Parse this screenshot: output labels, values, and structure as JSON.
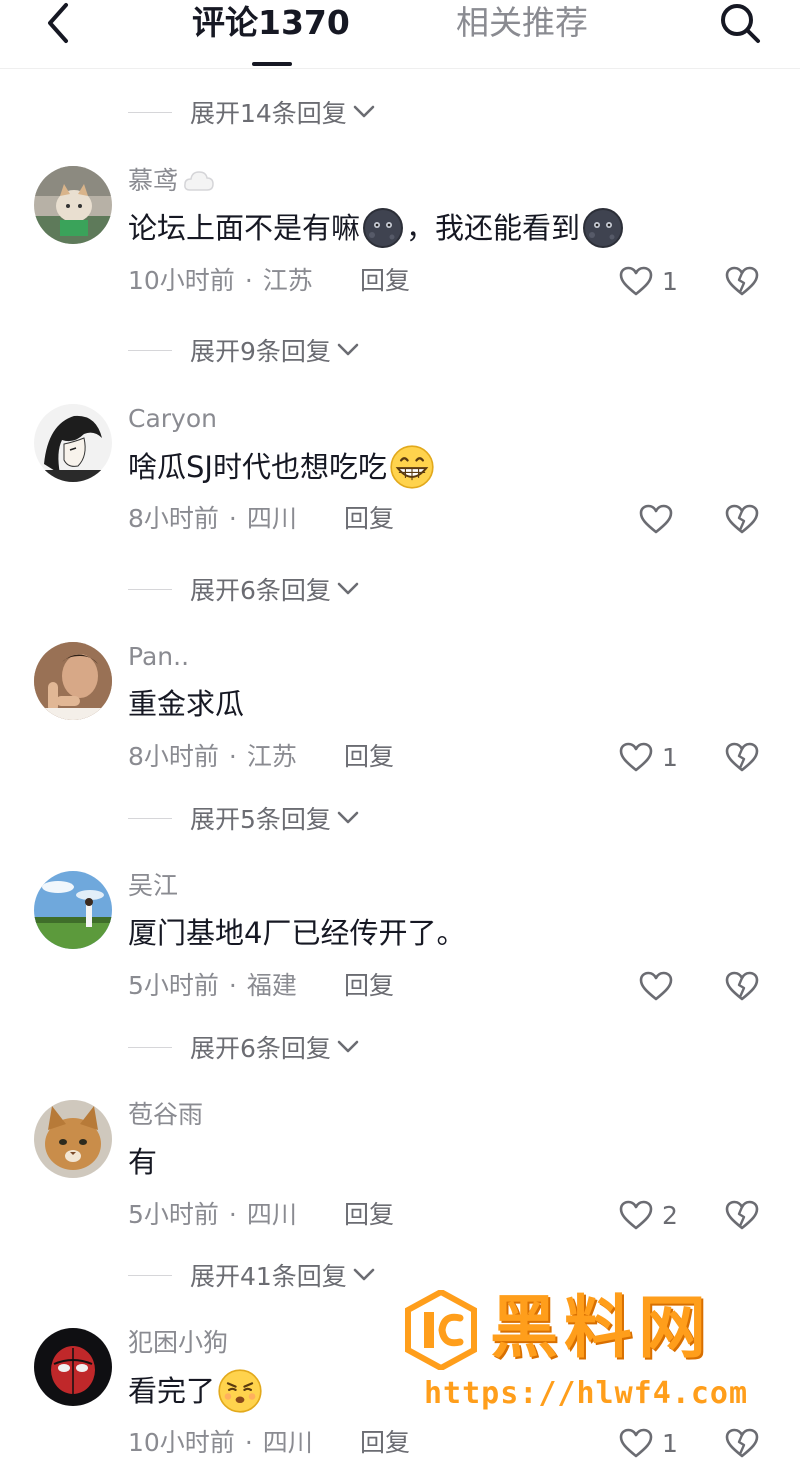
{
  "header": {
    "tab_comments": "评论1370",
    "tab_related": "相关推荐"
  },
  "expand_labels": [
    "展开14条回复",
    "展开9条回复",
    "展开6条回复",
    "展开5条回复",
    "展开6条回复",
    "展开41条回复"
  ],
  "comments": [
    {
      "user": "慕鸢",
      "text_a": "论坛上面不是有嘛",
      "text_b": "，我还能看到",
      "time": "10小时前",
      "location": "江苏",
      "reply": "回复",
      "likes": "1",
      "emoji": "dark-moon-face-emoji"
    },
    {
      "user": "Caryon",
      "text_a": "啥瓜SJ时代也想吃吃",
      "time": "8小时前",
      "location": "四川",
      "reply": "回复",
      "likes": "",
      "emoji": "grinning-face-emoji"
    },
    {
      "user": "Pan..",
      "text_a": "重金求瓜",
      "time": "8小时前",
      "location": "江苏",
      "reply": "回复",
      "likes": "1"
    },
    {
      "user": "吴江",
      "text_a": "厦门基地4厂已经传开了。",
      "time": "5小时前",
      "location": "福建",
      "reply": "回复",
      "likes": ""
    },
    {
      "user": "苞谷雨",
      "text_a": "有",
      "time": "5小时前",
      "location": "四川",
      "reply": "回复",
      "likes": "2"
    },
    {
      "user": "犯困小狗",
      "text_a": "看完了",
      "time": "10小时前",
      "location": "四川",
      "reply": "回复",
      "likes": "1",
      "emoji": "smirking-face-emoji"
    }
  ],
  "watermark": {
    "title": "黑料网",
    "url": "https://hlwf4.com"
  },
  "colors": {
    "text_primary": "#161823",
    "text_secondary": "#8a8b91",
    "watermark_orange": "#ff9e1b"
  }
}
